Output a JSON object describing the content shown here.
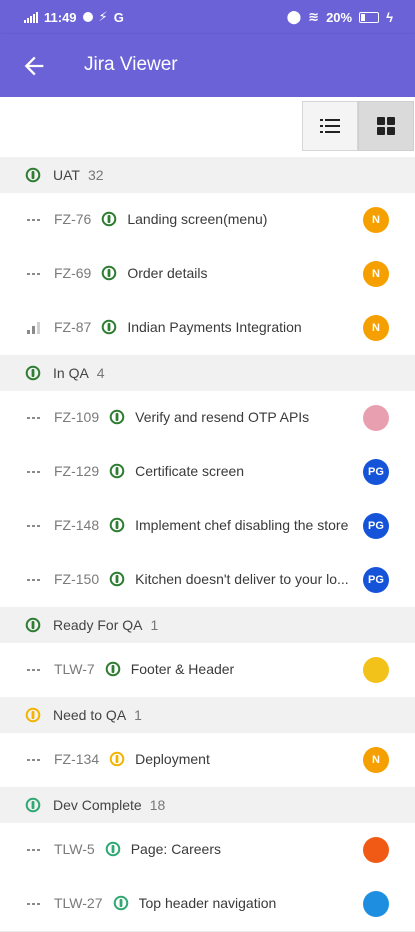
{
  "status_bar": {
    "time": "11:49",
    "g_label": "G",
    "battery": "20%"
  },
  "app_bar": {
    "title": "Jira Viewer"
  },
  "colors": {
    "primary": "#6a62d6",
    "green": "#2e7d32",
    "yellow": "#f2b400",
    "teal": "#2fa872",
    "orange": "#f5a000",
    "blue": "#1554d8"
  },
  "groups": [
    {
      "name": "UAT",
      "count": "32",
      "status_color": "#2e7d32",
      "items": [
        {
          "key": "FZ-76",
          "summary": "Landing screen(menu)",
          "priority": "dots",
          "avatar": "N",
          "avatar_color": "#f5a000"
        },
        {
          "key": "FZ-69",
          "summary": "Order details",
          "priority": "dots",
          "avatar": "N",
          "avatar_color": "#f5a000"
        },
        {
          "key": "FZ-87",
          "summary": "Indian Payments Integration",
          "priority": "bars",
          "avatar": "N",
          "avatar_color": "#f5a000"
        }
      ]
    },
    {
      "name": "In QA",
      "count": "4",
      "status_color": "#2e7d32",
      "items": [
        {
          "key": "FZ-109",
          "summary": "Verify and resend OTP APIs",
          "priority": "dots",
          "avatar": "",
          "avatar_color": "#e8a0b0"
        },
        {
          "key": "FZ-129",
          "summary": "Certificate screen",
          "priority": "dots",
          "avatar": "PG",
          "avatar_color": "#1554d8"
        },
        {
          "key": "FZ-148",
          "summary": "Implement chef disabling the store",
          "priority": "dots",
          "avatar": "PG",
          "avatar_color": "#1554d8"
        },
        {
          "key": "FZ-150",
          "summary": "Kitchen doesn't deliver to your lo...",
          "priority": "dots",
          "avatar": "PG",
          "avatar_color": "#1554d8"
        }
      ]
    },
    {
      "name": "Ready For QA",
      "count": "1",
      "status_color": "#2e7d32",
      "items": [
        {
          "key": "TLW-7",
          "summary": "Footer & Header",
          "priority": "dots",
          "avatar": "",
          "avatar_color": "#f3c21a"
        }
      ]
    },
    {
      "name": "Need to QA",
      "count": "1",
      "status_color": "#f2b400",
      "items": [
        {
          "key": "FZ-134",
          "summary": "Deployment",
          "priority": "dots",
          "avatar": "N",
          "avatar_color": "#f5a000"
        }
      ]
    },
    {
      "name": "Dev Complete",
      "count": "18",
      "status_color": "#2fa872",
      "items": [
        {
          "key": "TLW-5",
          "summary": "Page: Careers",
          "priority": "dots",
          "avatar": "",
          "avatar_color": "#f05a14"
        },
        {
          "key": "TLW-27",
          "summary": "Top header navigation",
          "priority": "dots",
          "avatar": "",
          "avatar_color": "#1e8fe0"
        }
      ]
    }
  ]
}
